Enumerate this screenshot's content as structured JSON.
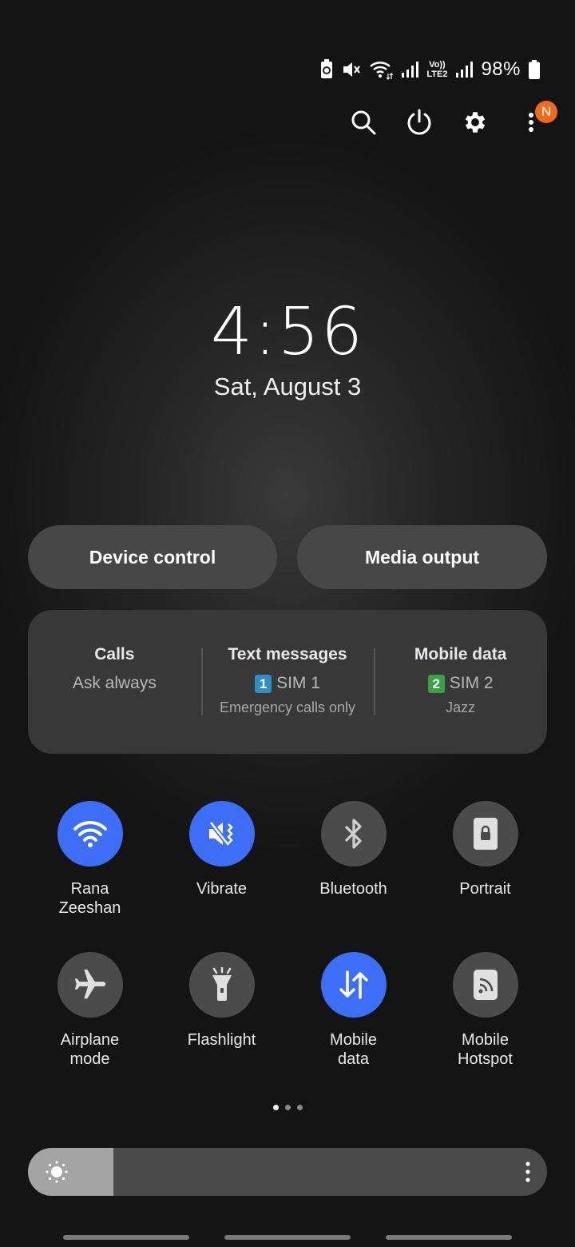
{
  "status": {
    "battery_pct": "98%",
    "network_label_top": "Vo))",
    "network_label_bottom": "LTE2"
  },
  "top_actions": {
    "notification_badge": "N"
  },
  "lockscreen": {
    "time": "4:56",
    "date": "Sat, August 3"
  },
  "pills": {
    "device_control": "Device control",
    "media_output": "Media output"
  },
  "sim": {
    "calls": {
      "title": "Calls",
      "value": "Ask always"
    },
    "text": {
      "title": "Text messages",
      "sim_num": "1",
      "sim_label": "SIM 1",
      "sub": "Emergency calls only",
      "sim_color": "#2f8fc4"
    },
    "data": {
      "title": "Mobile data",
      "sim_num": "2",
      "sim_label": "SIM 2",
      "sub": "Jazz",
      "sim_color": "#3aa04a"
    }
  },
  "tiles": [
    {
      "label": "Rana\nZeeshan",
      "icon": "wifi-icon",
      "active": true
    },
    {
      "label": "Vibrate",
      "icon": "vibrate-icon",
      "active": true
    },
    {
      "label": "Bluetooth",
      "icon": "bluetooth-icon",
      "active": false
    },
    {
      "label": "Portrait",
      "icon": "portrait-lock-icon",
      "active": false
    },
    {
      "label": "Airplane\nmode",
      "icon": "airplane-icon",
      "active": false
    },
    {
      "label": "Flashlight",
      "icon": "flashlight-icon",
      "active": false
    },
    {
      "label": "Mobile\ndata",
      "icon": "mobile-data-icon",
      "active": true
    },
    {
      "label": "Mobile\nHotspot",
      "icon": "hotspot-icon",
      "active": false
    }
  ],
  "brightness": {
    "level": 0.165
  },
  "colors": {
    "accent": "#3d6ef5",
    "badge": "#ef6a1d"
  }
}
